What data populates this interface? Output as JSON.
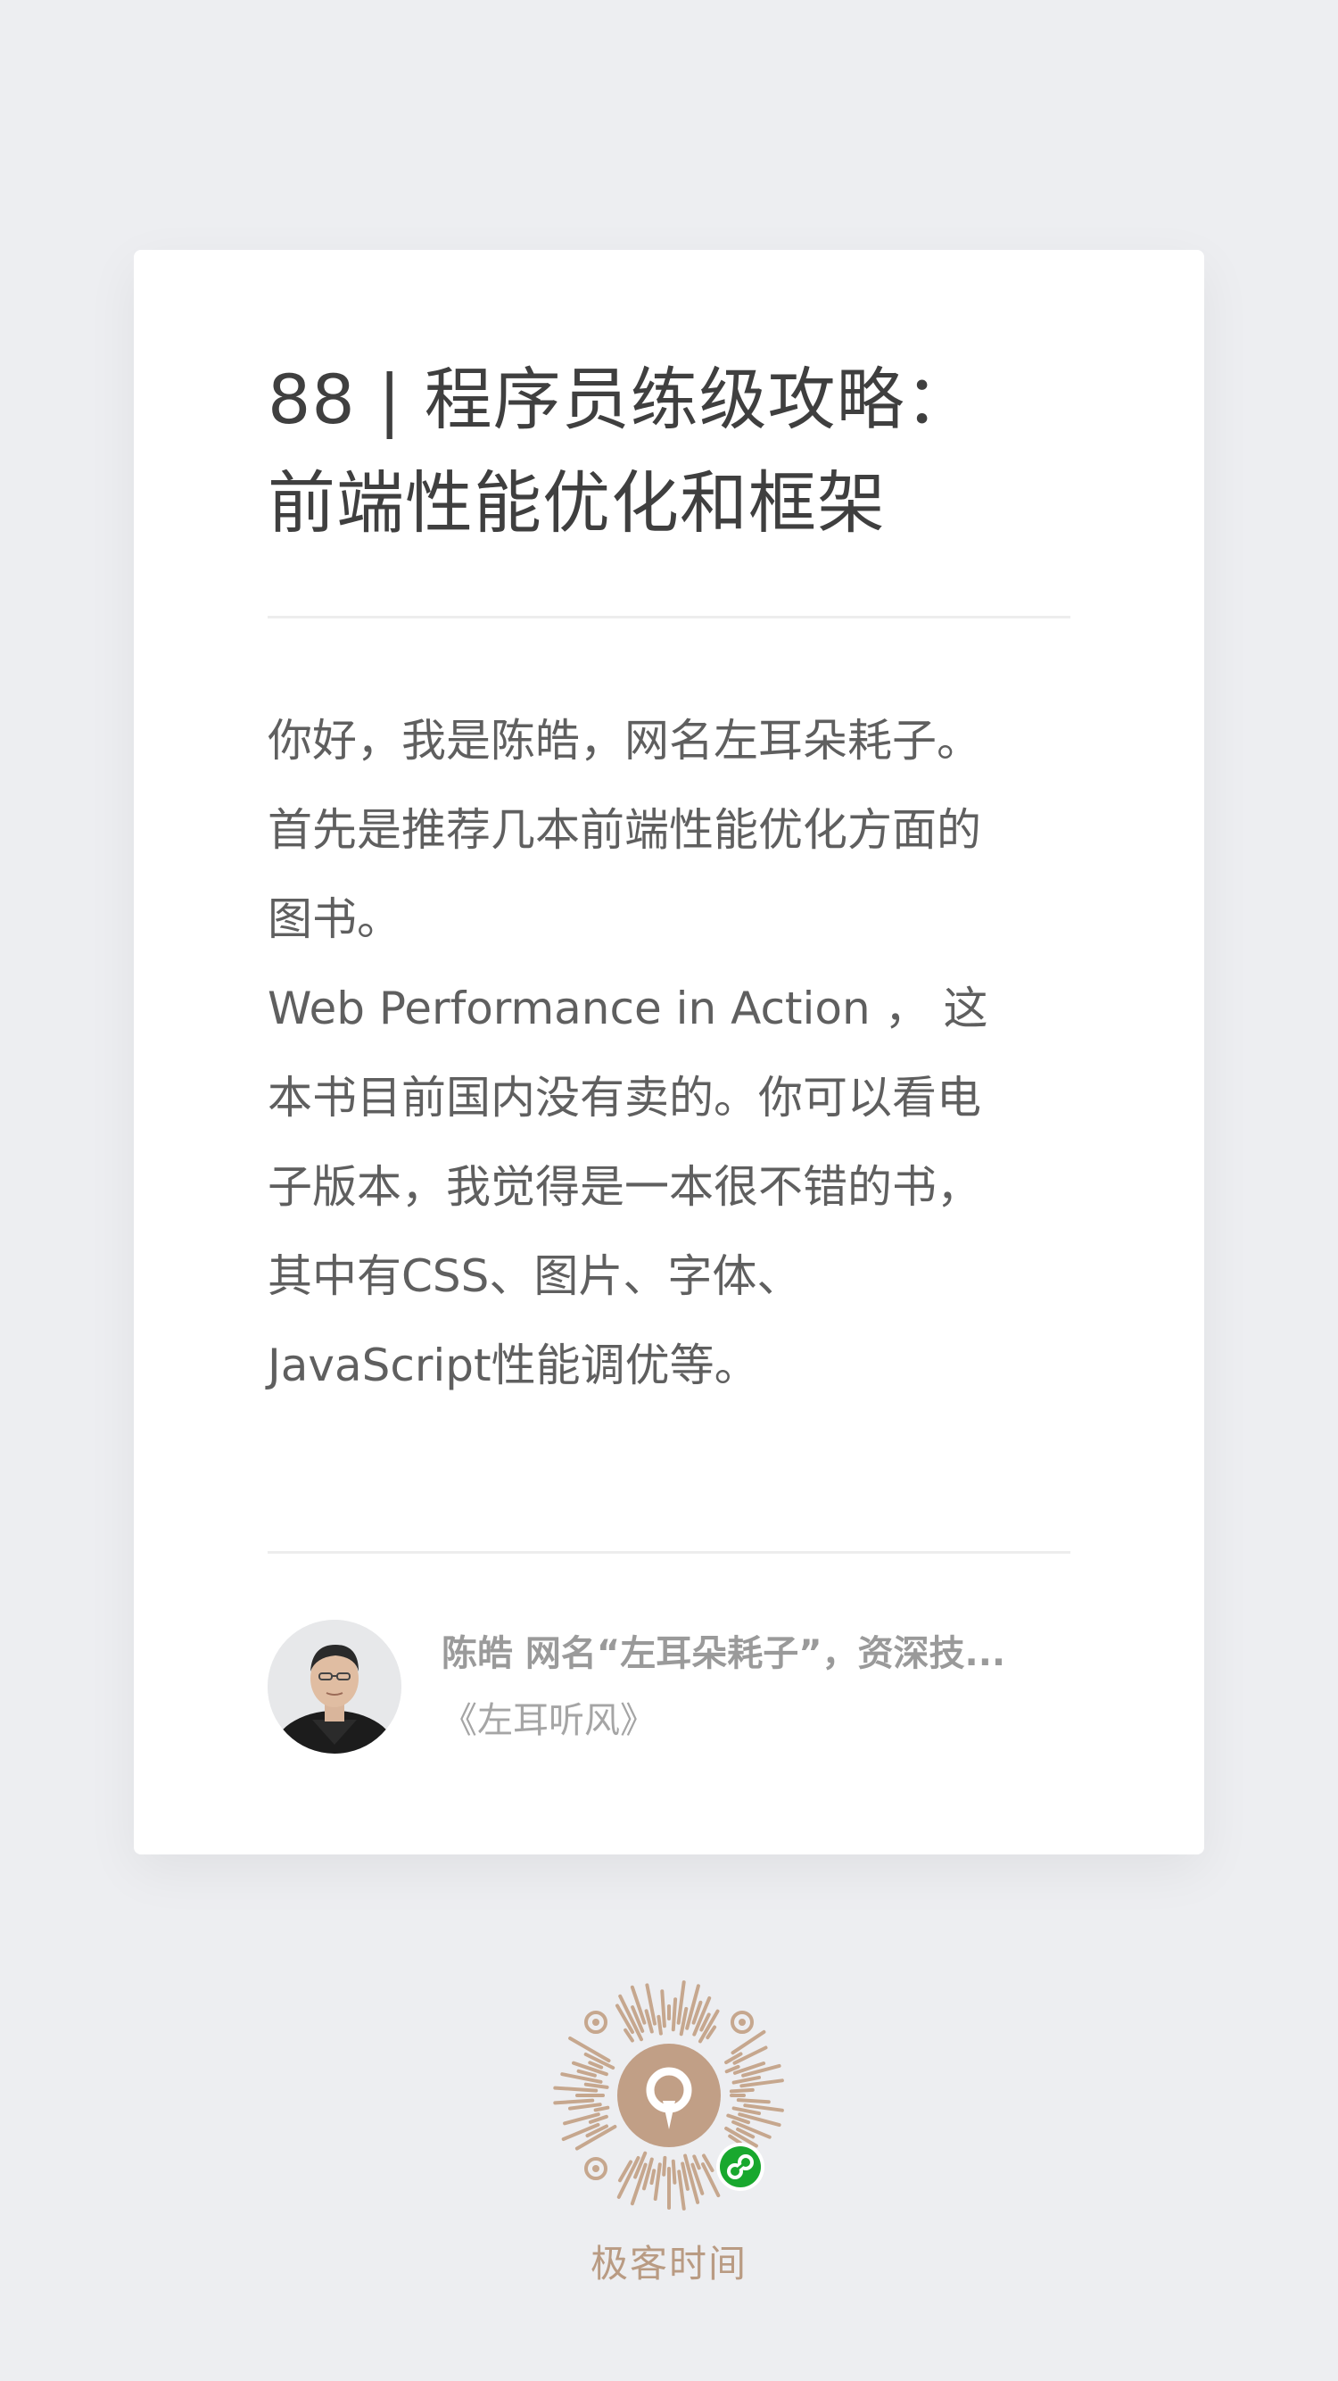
{
  "article": {
    "title_lines": [
      "88 | 程序员练级攻略：",
      "前端性能优化和框架"
    ],
    "body_lines": [
      "你好，我是陈皓，网名左耳朵耗子。",
      "首先是推荐几本前端性能优化方面的",
      "图书。",
      "Web Performance in Action ， 这",
      "本书目前国内没有卖的。你可以看电",
      "子版本，我觉得是一本很不错的书，",
      "其中有CSS、图片、字体、",
      "JavaScript性能调优等。"
    ]
  },
  "author": {
    "name": "陈皓 网名“左耳朵耗子”，资深技...",
    "book": "《左耳听风》",
    "avatar_icon": "author-portrait"
  },
  "footer": {
    "qr_icon": "mini-program-code-icon",
    "badge_icon": "mini-program-link-icon",
    "brand": "极客时间"
  },
  "colors": {
    "background": "#edeef1",
    "card": "#ffffff",
    "title": "#3f3f3f",
    "body": "#5f5f5f",
    "brand": "#b99b83",
    "badge": "#19a82e"
  }
}
